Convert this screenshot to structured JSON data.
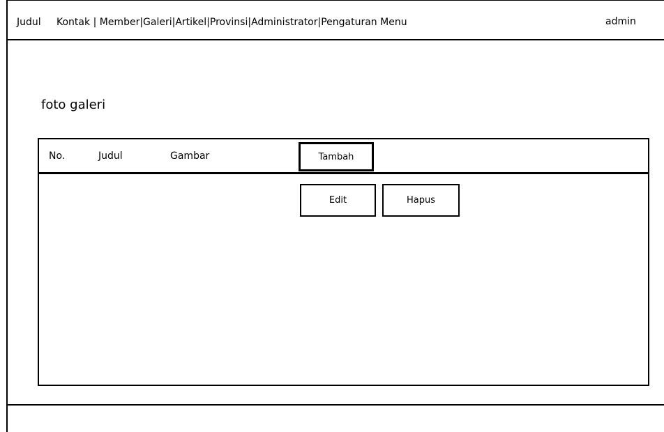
{
  "navbar": {
    "brand": "Judul",
    "menu": [
      {
        "label": "Kontak"
      },
      {
        "label": "Member"
      },
      {
        "label": "Galeri"
      },
      {
        "label": "Artikel"
      },
      {
        "label": "Provinsi"
      },
      {
        "label": "Administrator"
      },
      {
        "label": "Pengaturan Menu"
      }
    ],
    "separator": "|",
    "user": "admin"
  },
  "page": {
    "title": "foto galeri"
  },
  "table": {
    "columns": [
      "No.",
      "Judul",
      "Gambar"
    ],
    "add_label": "Tambah",
    "rows": [
      {
        "edit_label": "Edit",
        "delete_label": "Hapus"
      }
    ]
  }
}
